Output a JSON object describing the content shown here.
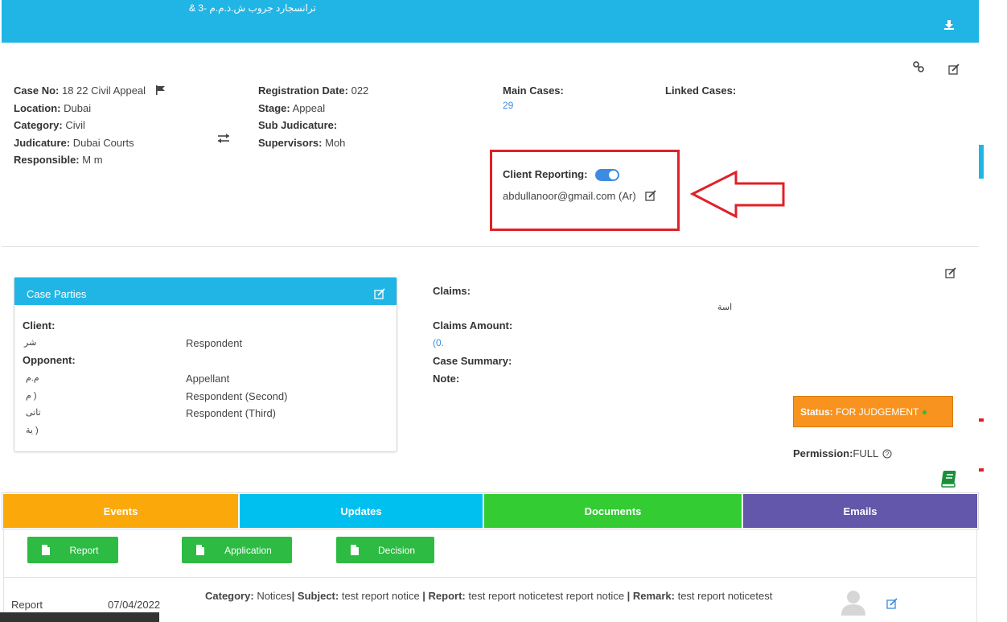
{
  "header": {
    "title": "& 3- ترانسجارد جروب ش.ذ.م.م"
  },
  "case": {
    "col1": [
      {
        "label": "Case No:",
        "value": "18        22 Civil Appeal"
      },
      {
        "label": "Location:",
        "value": "Dubai"
      },
      {
        "label": "Category:",
        "value": "Civil"
      },
      {
        "label": "Judicature:",
        "value": "Dubai Courts"
      },
      {
        "label": "Responsible:",
        "value": "M                       m"
      }
    ],
    "col2": [
      {
        "label": "Registration Date:",
        "value": "          022"
      },
      {
        "label": "Stage:",
        "value": "Appeal"
      },
      {
        "label": "Sub Judicature:",
        "value": ""
      },
      {
        "label": "Supervisors:",
        "value": "Moh"
      }
    ],
    "main_cases_label": "Main Cases:",
    "main_cases_value": "29",
    "linked_cases_label": "Linked Cases:"
  },
  "client_reporting": {
    "label": "Client Reporting:",
    "enabled": true,
    "email": "abdullanoor@gmail.com (Ar)"
  },
  "parties": {
    "title": "Case Parties",
    "client_label": "Client:",
    "clients": [
      {
        "name": "شر",
        "role": "Respondent"
      }
    ],
    "opponent_label": "Opponent:",
    "opponents": [
      {
        "name": "م.م",
        "role": "Appellant"
      },
      {
        "name": "م )",
        "role": "Respondent (Second)"
      },
      {
        "name": "تاتى",
        "role": "Respondent (Third)"
      },
      {
        "name": "ية )",
        "role": ""
      }
    ]
  },
  "claims": {
    "claims_label": "Claims:",
    "claims_value": "اسة",
    "amount_label": "Claims Amount:",
    "amount_value": "(0.",
    "summary_label": "Case Summary:",
    "note_label": "Note:"
  },
  "status": {
    "label": "Status:",
    "value": "FOR JUDGEMENT",
    "dot_color": "#2dbb44"
  },
  "permission": {
    "label": "Permission:",
    "value": "FULL"
  },
  "tabs": [
    {
      "label": "Events",
      "color": "#fba90a"
    },
    {
      "label": "Updates",
      "color": "#00c0f0"
    },
    {
      "label": "Documents",
      "color": "#33cc33"
    },
    {
      "label": "Emails",
      "color": "#6257ab"
    }
  ],
  "doc_buttons": [
    {
      "label": "Report"
    },
    {
      "label": "Application"
    },
    {
      "label": "Decision"
    }
  ],
  "event_row": {
    "type": "Report",
    "date": "07/04/2022",
    "category_label": "Category:",
    "category": "Notices",
    "subject_label": "Subject:",
    "subject": "test report notice",
    "report_label": "Report:",
    "report": "test report noticetest report notice",
    "remark_label": "Remark:",
    "remark": "test report noticetest"
  }
}
